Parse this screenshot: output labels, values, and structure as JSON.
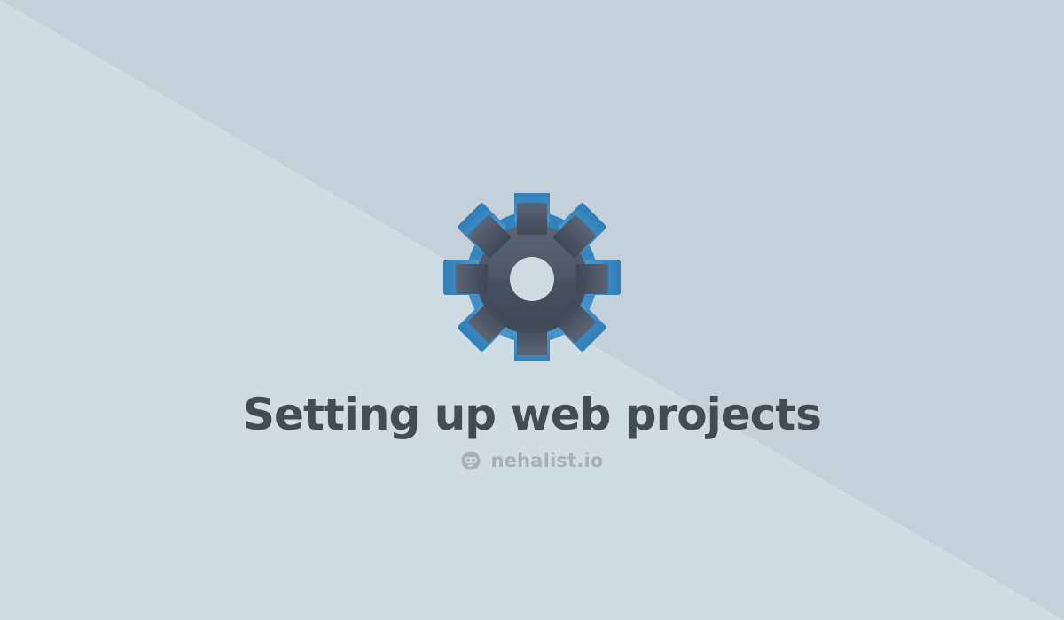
{
  "colors": {
    "background_light": "#cfdce4",
    "background_dark": "#c4d1da",
    "gear_inner": "#4b5564",
    "gear_outer": "#2f7fb8",
    "title": "#434b55",
    "brand": "#a7b0ba"
  },
  "hero": {
    "icon": "gear-icon",
    "title": "Setting up web projects"
  },
  "brand": {
    "icon": "robot-logo-icon",
    "name": "nehalist.io"
  }
}
